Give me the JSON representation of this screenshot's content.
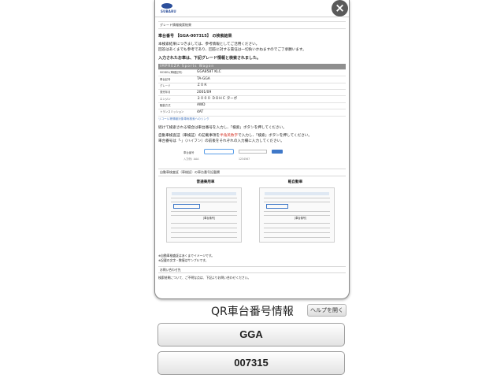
{
  "modal": {
    "logo_text": "SUBARU",
    "section_header": "グレード情報検索結果",
    "result_title": "車台番号 【GGA-007315】 の検索結果",
    "para1": "本検索結果につきましては、参考情報としてご活用ください。",
    "para2": "回答はあくまでも参考であり、回答に対する責任は一切負いかねますのでご了承願います。",
    "entered_heading": "入力されたお車は、下記グレード情報と検索されました。",
    "spec_header": "IMPREZA Sports Wagon",
    "spec_rows": [
      {
        "k": "MODEL(車種記号)",
        "v": "GGA858T KLC"
      },
      {
        "k": "車台記号",
        "v": "TA-GGA"
      },
      {
        "k": "グレード",
        "v": "Ｚ０Ｋ"
      },
      {
        "k": "発売年月",
        "v": "2001/09"
      },
      {
        "k": "エンジン",
        "v": "２０００ ＤＯＨＣ ターボ"
      },
      {
        "k": "駆動方式",
        "v": "AWD"
      },
      {
        "k": "トランスミッション",
        "v": "4AT"
      }
    ],
    "recall_link": "リコール等情報対象車両検索へのリンク",
    "continue_note": "続けて検索される場合は車台番号を入力し、「検索」ボタンを押してください。",
    "instruction1_a": "自動車検査証（車検証）の記載事項を",
    "instruction1_red": "半角英数字",
    "instruction1_b": "で入力し、「検索」ボタンを押してください。",
    "instruction2": "車台番号は「-」（ハイフン）の前後をそれぞれの入力欄に入力してください。",
    "input_label": "車台番号",
    "example_a": "入力例）AAA",
    "example_b": "1234567",
    "cert_section": "自動車検査証（車検証）の車台番号記載欄",
    "cert_left_title": "普通乗用車",
    "cert_right_title": "軽自動車",
    "cert_tag": "[車台番号]",
    "foot1": "※自動車検査証はあくまでイメージです。",
    "foot2": "※記載の文字・数値はサンプルです。",
    "contact_head": "お問い合わせ先",
    "contact_text": "検索結果について、ご不明な点は、下記よりお問い合わせください。"
  },
  "close_label": "×",
  "qr": {
    "title": "QR車台番号情報",
    "help_label": "ヘルプを開く",
    "field1": "GGA",
    "field2": "007315"
  }
}
